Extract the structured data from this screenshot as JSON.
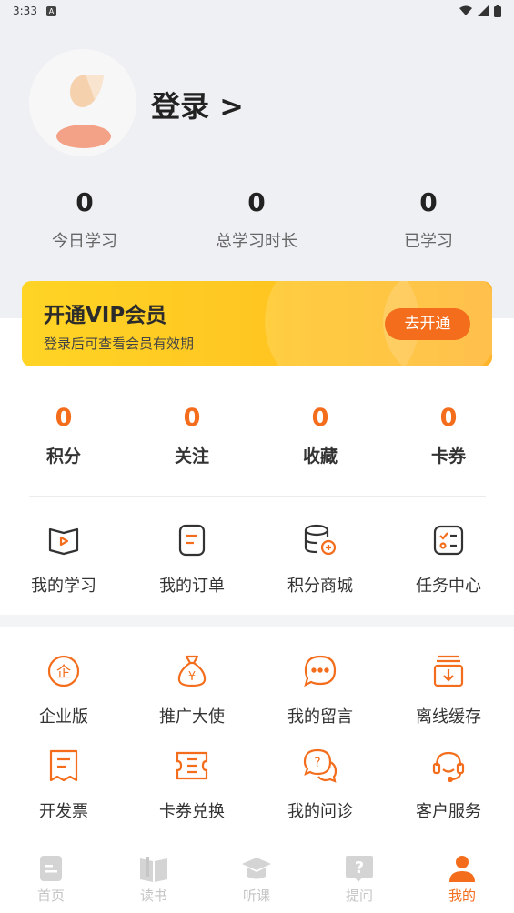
{
  "status_bar": {
    "time": "3:33",
    "notif_glyph": "A"
  },
  "profile": {
    "login_label": "登录 >"
  },
  "stats": [
    {
      "value": "0",
      "label": "今日学习"
    },
    {
      "value": "0",
      "label": "总学习时长"
    },
    {
      "value": "0",
      "label": "已学习"
    }
  ],
  "vip": {
    "title": "开通VIP会员",
    "subtitle": "登录后可查看会员有效期",
    "button": "去开通"
  },
  "counts": [
    {
      "value": "0",
      "label": "积分"
    },
    {
      "value": "0",
      "label": "关注"
    },
    {
      "value": "0",
      "label": "收藏"
    },
    {
      "value": "0",
      "label": "卡券"
    }
  ],
  "primary_menu": [
    {
      "label": "我的学习",
      "icon": "study-book-icon"
    },
    {
      "label": "我的订单",
      "icon": "order-doc-icon"
    },
    {
      "label": "积分商城",
      "icon": "points-coins-icon"
    },
    {
      "label": "任务中心",
      "icon": "task-list-icon"
    }
  ],
  "services": [
    {
      "label": "企业版",
      "icon": "enterprise-icon"
    },
    {
      "label": "推广大使",
      "icon": "money-bag-icon"
    },
    {
      "label": "我的留言",
      "icon": "message-bubble-icon"
    },
    {
      "label": "离线缓存",
      "icon": "download-icon"
    },
    {
      "label": "开发票",
      "icon": "invoice-icon"
    },
    {
      "label": "卡券兑换",
      "icon": "coupon-icon"
    },
    {
      "label": "我的问诊",
      "icon": "question-chat-icon"
    },
    {
      "label": "客户服务",
      "icon": "headset-icon"
    }
  ],
  "tabs": [
    {
      "label": "首页",
      "icon": "home-icon",
      "active": false
    },
    {
      "label": "读书",
      "icon": "book-icon",
      "active": false
    },
    {
      "label": "听课",
      "icon": "course-cap-icon",
      "active": false
    },
    {
      "label": "提问",
      "icon": "question-icon",
      "active": false
    },
    {
      "label": "我的",
      "icon": "profile-icon",
      "active": true
    }
  ],
  "colors": {
    "accent": "#f36d1c",
    "vip_gradient_start": "#ffd425",
    "vip_gradient_end": "#ffb42a",
    "header_bg": "#eef0f3"
  }
}
